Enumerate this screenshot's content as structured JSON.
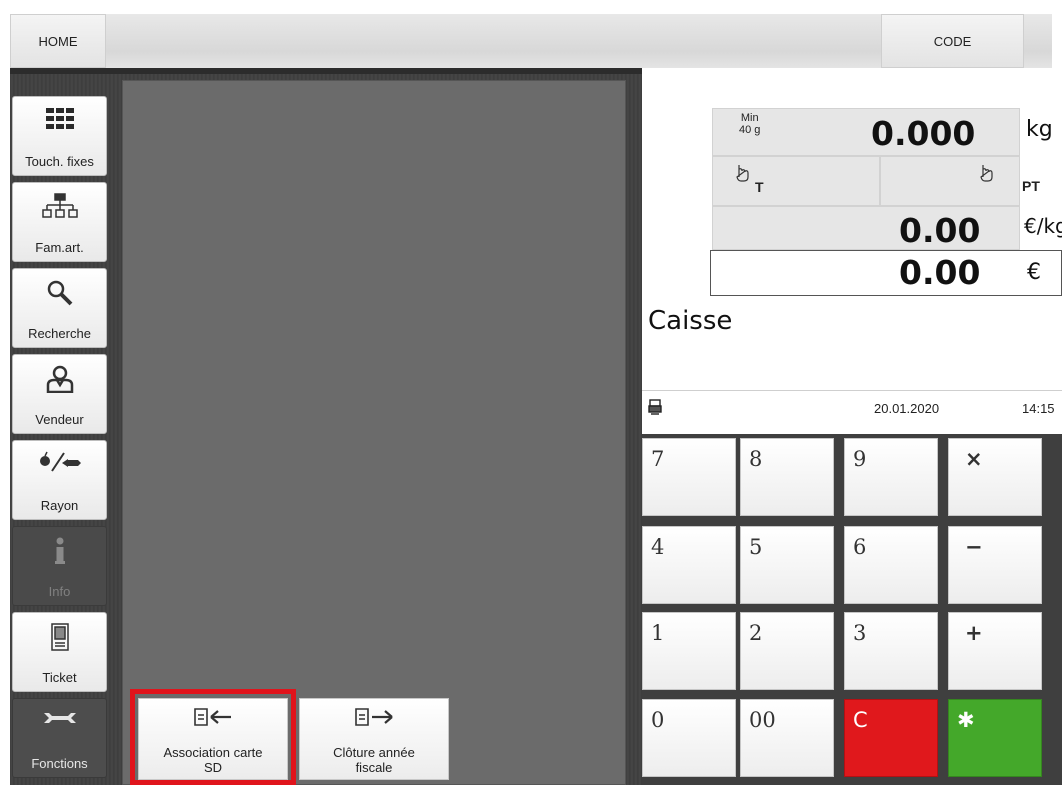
{
  "topbar": {
    "home_label": "HOME",
    "code_label": "CODE"
  },
  "nav": {
    "items": [
      {
        "label": "Touch. fixes",
        "icon": "grid-icon"
      },
      {
        "label": "Fam.art.",
        "icon": "hierarchy-icon"
      },
      {
        "label": "Recherche",
        "icon": "magnifier-icon"
      },
      {
        "label": "Vendeur",
        "icon": "salesperson-icon"
      },
      {
        "label": "Rayon",
        "icon": "department-icon"
      },
      {
        "label": "Info",
        "icon": "info-icon"
      },
      {
        "label": "Ticket",
        "icon": "receipt-icon"
      },
      {
        "label": "Fonctions",
        "icon": "wrench-icon"
      }
    ]
  },
  "functions": {
    "association": {
      "line1": "Association carte",
      "line2": "SD"
    },
    "cloture": {
      "line1": "Clôture année",
      "line2": "fiscale"
    }
  },
  "scale": {
    "min_label": "Min",
    "min_value": "40 g",
    "weight": "0.000",
    "weight_unit": "kg",
    "tare_label": "T",
    "preset_tare_label": "PT",
    "price_per_kg": "0.00",
    "price_unit": "€/kg",
    "total": "0.00",
    "total_unit": "€"
  },
  "mode_label": "Caisse",
  "status": {
    "date": "20.01.2020",
    "time": "14:15"
  },
  "keypad": {
    "k7": "7",
    "k8": "8",
    "k9": "9",
    "kmul": "×",
    "k4": "4",
    "k5": "5",
    "k6": "6",
    "kminus": "−",
    "k1": "1",
    "k2": "2",
    "k3": "3",
    "kplus": "+",
    "k0": "0",
    "k00": "00",
    "kclear": "C",
    "kenter": "✱"
  },
  "colors": {
    "clear_key": "#e0181c",
    "enter_key": "#44a82a",
    "highlight": "#e0141c"
  }
}
